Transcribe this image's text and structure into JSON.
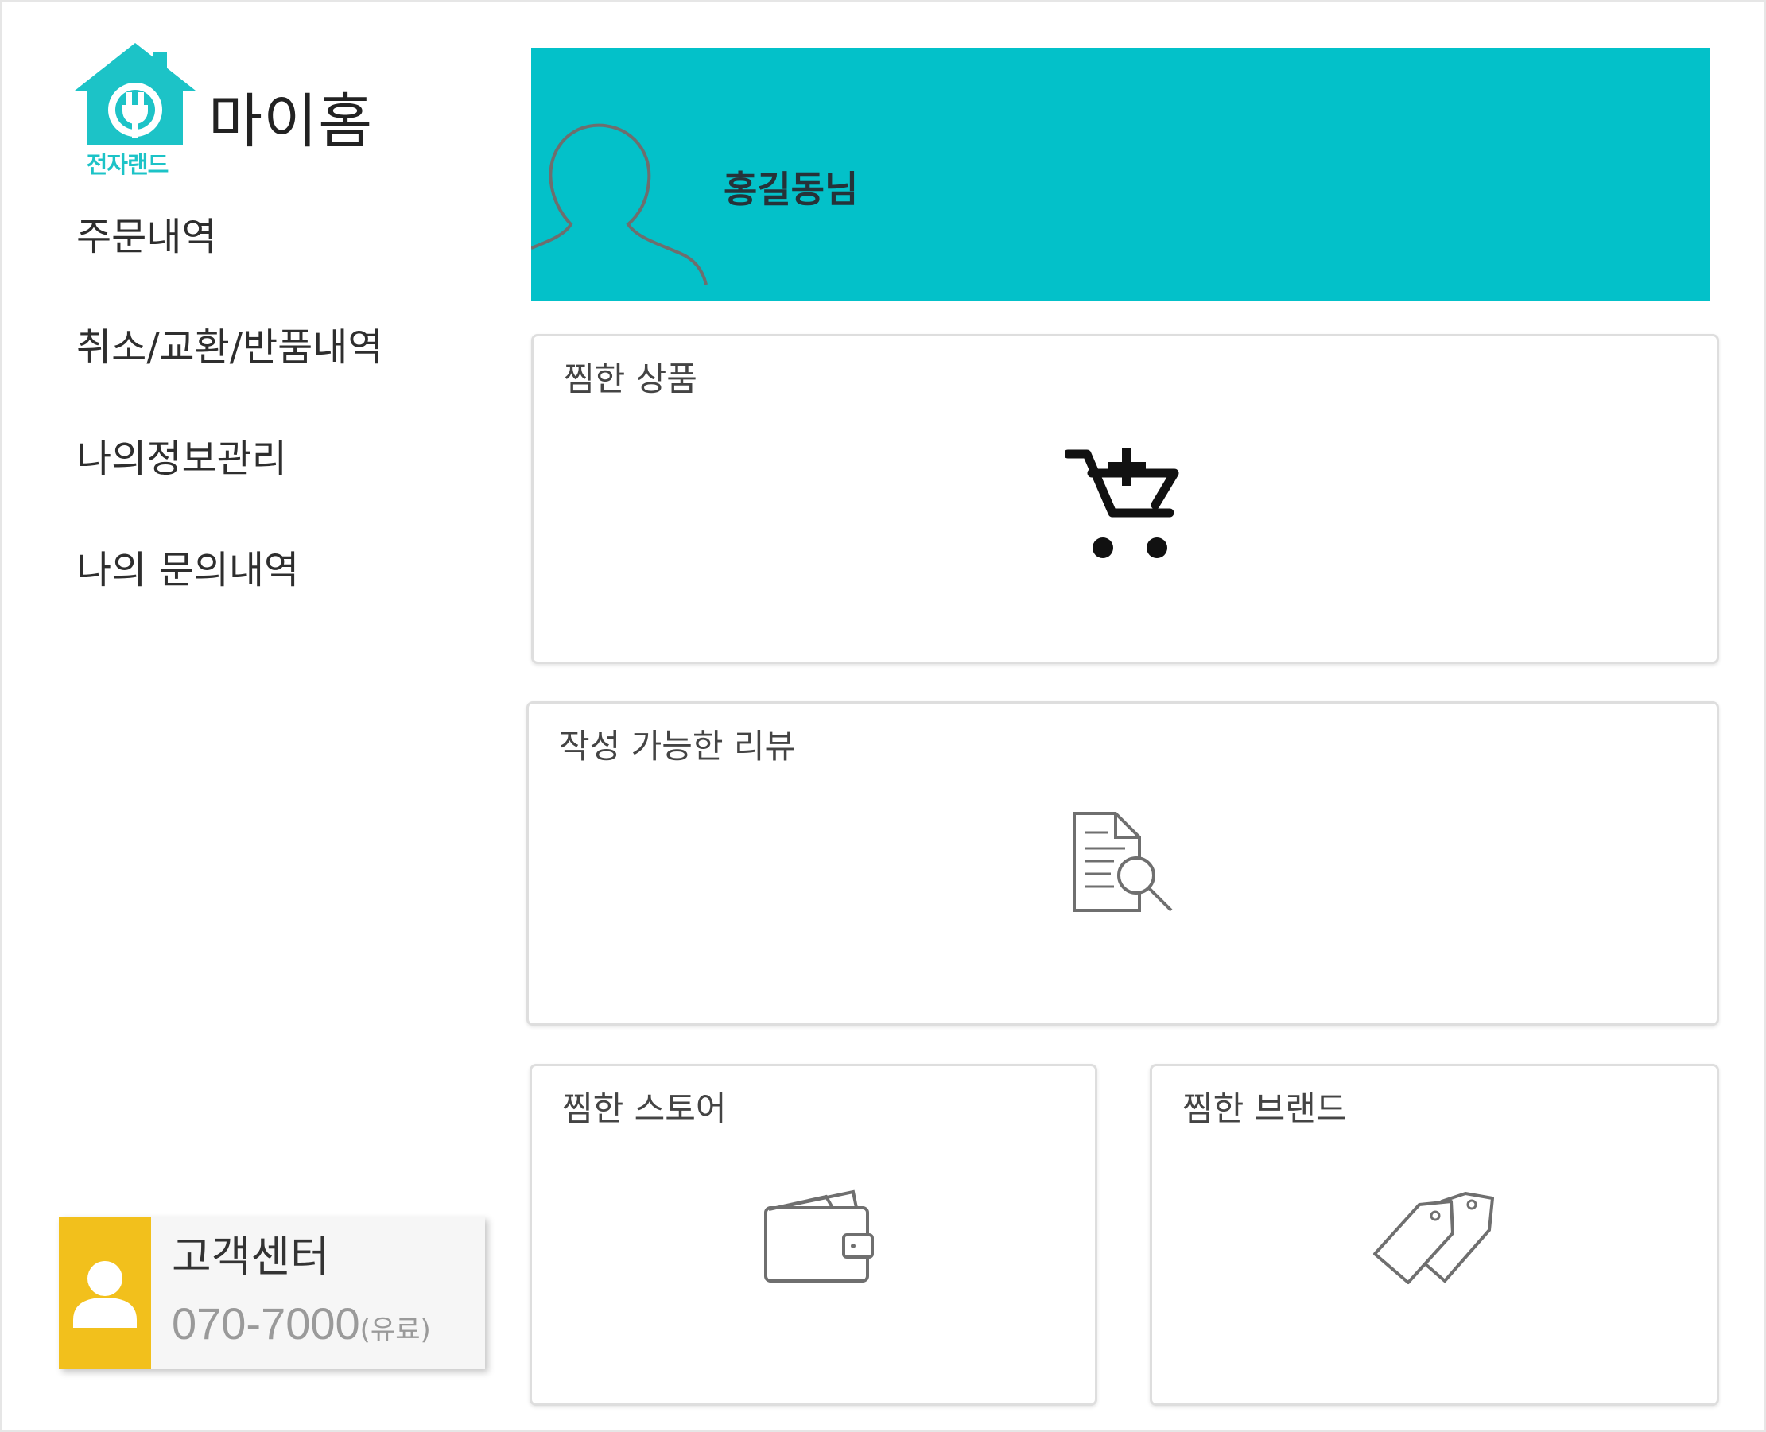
{
  "header": {
    "brand_text": "전자랜드",
    "page_title": "마이홈"
  },
  "menu": {
    "items": [
      {
        "label": "주문내역"
      },
      {
        "label": "취소/교환/반품내역"
      },
      {
        "label": "나의정보관리"
      },
      {
        "label": "나의 문의내역"
      }
    ]
  },
  "customer_center": {
    "title": "고객센터",
    "phone": "070-7000",
    "phone_note": "(유료)",
    "icon": "person-icon",
    "accent_color": "#f2c01c"
  },
  "profile": {
    "user_name": "홍길동님",
    "icon": "avatar-silhouette-icon",
    "background_color": "#03c1c9"
  },
  "cards": {
    "wishlist_products": {
      "title": "찜한 상품",
      "icon": "cart-plus-icon"
    },
    "writable_reviews": {
      "title": "작성 가능한 리뷰",
      "icon": "document-search-icon"
    },
    "wishlist_stores": {
      "title": "찜한 스토어",
      "icon": "wallet-icon"
    },
    "wishlist_brands": {
      "title": "찜한 브랜드",
      "icon": "price-tags-icon"
    }
  }
}
